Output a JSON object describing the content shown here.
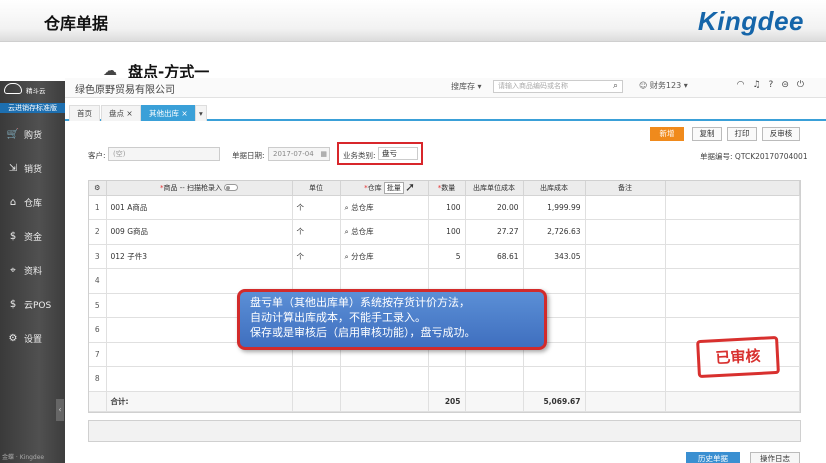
{
  "slide": {
    "title": "仓库单据",
    "subtitle": "盘点-方式一",
    "brand": "Kingdee"
  },
  "app": {
    "logo_text": "精斗云",
    "edition": "云进销存标准版",
    "company": "绿色原野贸易有限公司",
    "search_scope": "搜库存",
    "search_placeholder": "请输入商品编码或名称",
    "user": "财务123",
    "footer": "金蝶 · Kingdee"
  },
  "sidebar": {
    "items": [
      {
        "label": "购货",
        "icon": "cart-icon",
        "glyph": "🛒"
      },
      {
        "label": "销货",
        "icon": "sales-icon",
        "glyph": "⇲"
      },
      {
        "label": "仓库",
        "icon": "warehouse-icon",
        "glyph": "⌂"
      },
      {
        "label": "资金",
        "icon": "money-icon",
        "glyph": "$"
      },
      {
        "label": "资料",
        "icon": "data-icon",
        "glyph": "⌖"
      },
      {
        "label": "云POS",
        "icon": "pos-icon",
        "glyph": "$"
      },
      {
        "label": "设置",
        "icon": "settings-icon",
        "glyph": "⚙"
      }
    ]
  },
  "tabs": [
    "首页",
    "盘点",
    "其他出库"
  ],
  "toolbar": {
    "add": "新增",
    "copy": "复制",
    "print": "打印",
    "unaudit": "反审核"
  },
  "form": {
    "customer_label": "客户:",
    "customer_placeholder": "(空)",
    "date_label": "单据日期:",
    "date_value": "2017-07-04",
    "biz_type_label": "业务类别:",
    "biz_type_value": "盘亏",
    "doc_no": "单据编号: QTCK20170704001"
  },
  "grid": {
    "headers": {
      "product": "商品 -- 扫描枪录入",
      "unit": "单位",
      "warehouse": "仓库",
      "batch": "批量",
      "qty": "数量",
      "unit_cost": "出库单位成本",
      "cost": "出库成本",
      "remark": "备注"
    },
    "rows": [
      {
        "idx": "1",
        "product": "001 A商品",
        "unit": "个",
        "warehouse": "总仓库",
        "qty": "100",
        "unit_cost": "20.00",
        "cost": "1,999.99"
      },
      {
        "idx": "2",
        "product": "009 G商品",
        "unit": "个",
        "warehouse": "总仓库",
        "qty": "100",
        "unit_cost": "27.27",
        "cost": "2,726.63"
      },
      {
        "idx": "3",
        "product": "012 子件3",
        "unit": "个",
        "warehouse": "分仓库",
        "qty": "5",
        "unit_cost": "68.61",
        "cost": "343.05"
      },
      {
        "idx": "4"
      },
      {
        "idx": "5"
      },
      {
        "idx": "6"
      },
      {
        "idx": "7"
      },
      {
        "idx": "8"
      }
    ],
    "total_label": "合计:",
    "total_qty": "205",
    "total_cost": "5,069.67"
  },
  "stamp": "已审核",
  "callout": {
    "line1": "盘亏单（其他出库单）系统按存货计价方法，",
    "line2": "自动计算出库成本，不能手工录入。",
    "line3": "保存或是审核后（启用审核功能），盘亏成功。"
  },
  "bottom": {
    "history": "历史单据",
    "log": "操作日志"
  }
}
